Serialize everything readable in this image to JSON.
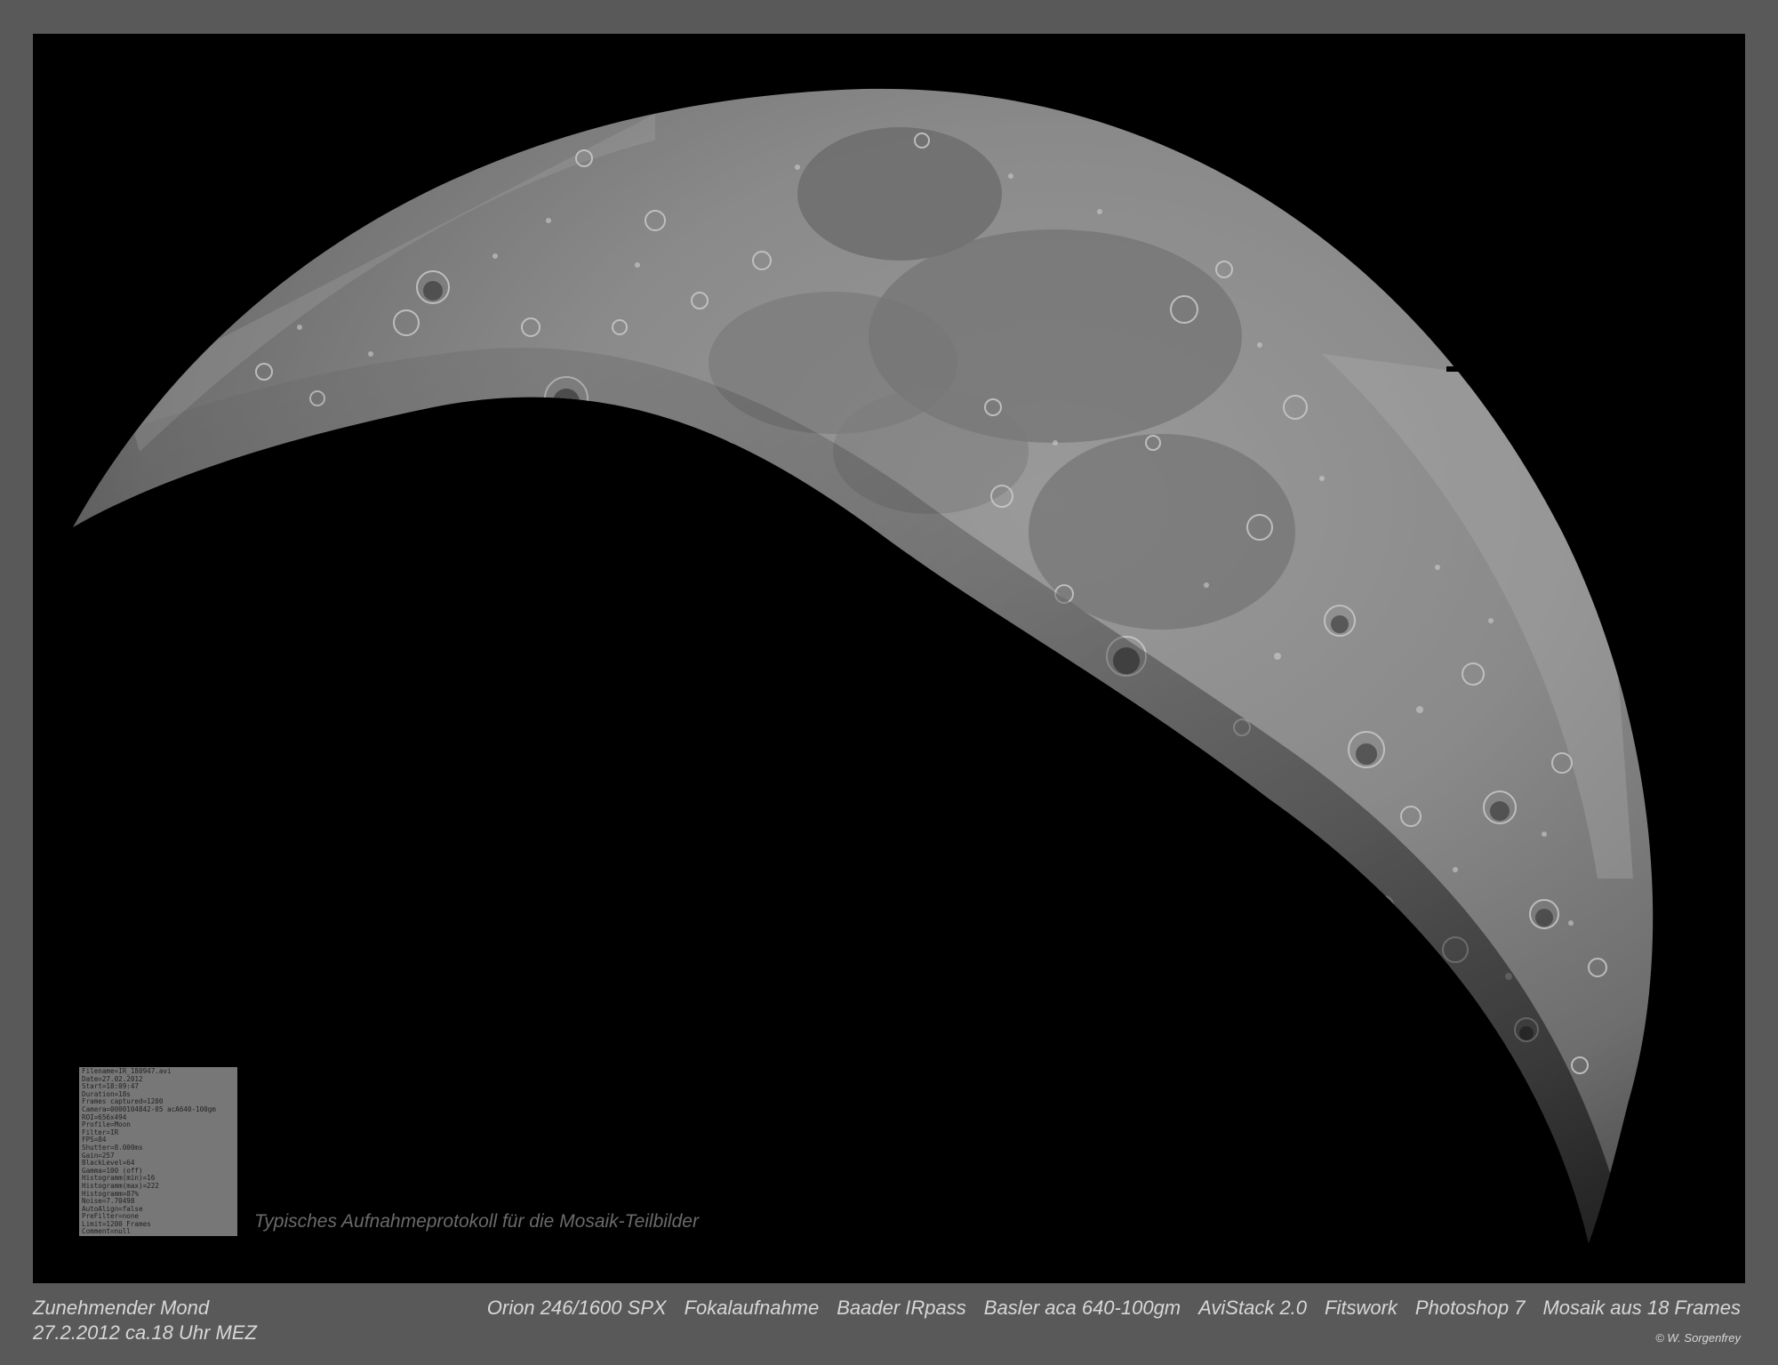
{
  "caption": {
    "title": "Zunehmender Mond",
    "date": "27.2.2012 ca.18 Uhr MEZ",
    "equipment": [
      "Orion 246/1600 SPX",
      "Fokalaufnahme",
      "Baader IRpass",
      "Basler aca 640-100gm",
      "AviStack 2.0",
      "Fitswork",
      "Photoshop 7",
      "Mosaik aus 18 Frames"
    ],
    "copyright": "© W. Sorgenfrey"
  },
  "log": {
    "caption": "Typisches Aufnahmeprotokoll für die Mosaik-Teilbilder",
    "lines": [
      "Filename=IR_180947.avi",
      "Date=27.02.2012",
      "Start=18:09:47",
      "Duration=18s",
      "Frames captured=1200",
      "Camera=0000104842-05 acA640-100gm",
      "ROI=656x494",
      "Profile=Moon",
      "Filter=IR",
      "FPS=84",
      "Shutter=8.000ms",
      "Gain=257",
      "BlackLevel=64",
      "Gamma=100 (off)",
      "Histogramm(min)=16",
      "Histogramm(max)=222",
      "Histogramm=87%",
      "Noise=7.70498",
      "AutoAlign=false",
      "PreFilter=none",
      "Limit=1200 Frames",
      "Comment=null"
    ]
  },
  "colors": {
    "frame": "#595959",
    "sky": "#000000",
    "caption_text": "#d7d7d7"
  }
}
